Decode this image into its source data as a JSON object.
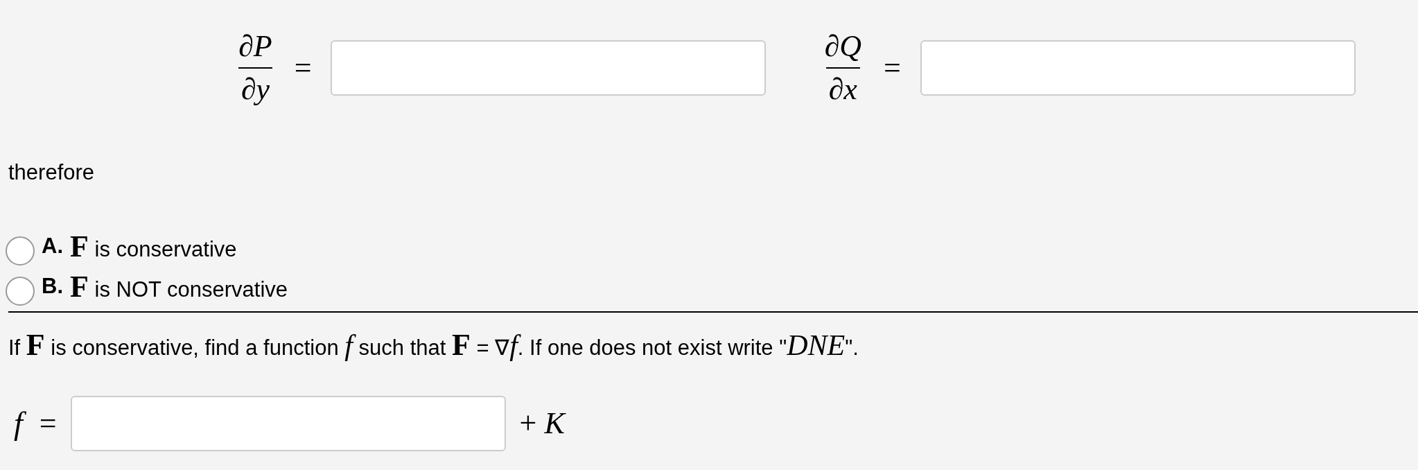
{
  "partials": [
    {
      "numerator": "∂P",
      "denominator": "∂y",
      "equals": "="
    },
    {
      "numerator": "∂Q",
      "denominator": "∂x",
      "equals": "="
    }
  ],
  "therefore": "therefore",
  "options": [
    {
      "letter": "A.",
      "text": "**F** is conservative",
      "selected": false
    },
    {
      "letter": "B.",
      "text": "**F** is NOT conservative",
      "selected": false
    }
  ],
  "prompt": "If **F** is conservative, find a function *f* such that **F** = ∇*f*. If one does not exist write \"*DNE*\".",
  "answer": {
    "variable": "f",
    "equals": "=",
    "suffix": "+ *K*"
  }
}
